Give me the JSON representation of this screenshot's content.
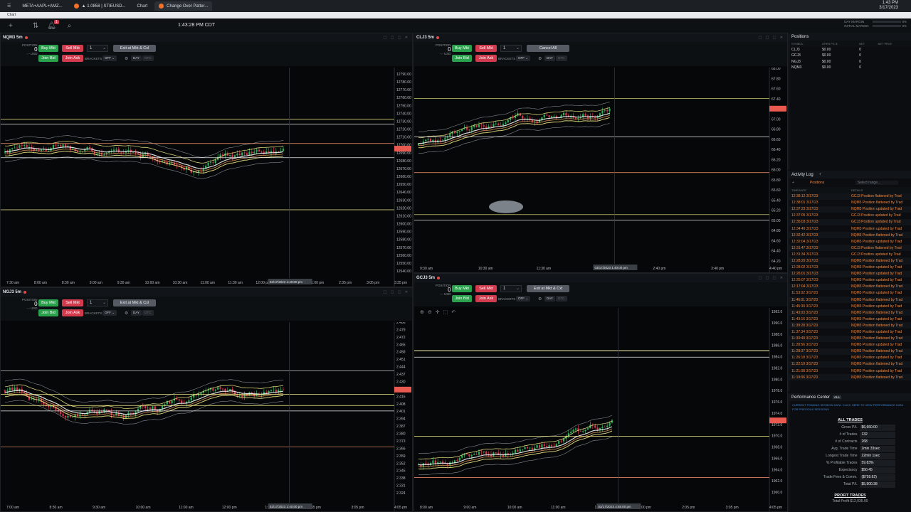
{
  "browser": {
    "tabs": [
      {
        "label": "META+AAPL+AMZ..."
      },
      {
        "label": "▲ 1.0858 | STIEUSD..."
      },
      {
        "label": "Chart"
      },
      {
        "label": "Change Over Patter..."
      }
    ],
    "clock_time": "1:43 PM",
    "clock_date": "3/17/2023",
    "address": "Chart"
  },
  "app": {
    "time": "1:43:28 PM CDT",
    "notification_count": "1",
    "day_margin_label": "DAY MARGIN",
    "day_margin_value": "0%",
    "initial_margin_label": "INITIAL MARGIN",
    "initial_margin_value": "0%"
  },
  "order_labels": {
    "buy": "Buy Mkt",
    "sell": "Sell Mkt",
    "join_bid": "Join Bid",
    "join_ask": "Join Ask",
    "position": "POSITION",
    "usd": "-.- USD",
    "brackets": "BRACKETS",
    "off": "OFF",
    "day": "DAY",
    "gtc": "GTC"
  },
  "charts": [
    {
      "symbol": "NQM3 5m",
      "qty": "1",
      "exit_label": "Exit at Mkt & Cxl",
      "position": "0",
      "y_ticks": [
        "12790.00",
        "12780.00",
        "12770.00",
        "12760.00",
        "12750.00",
        "12740.00",
        "12730.00",
        "12720.00",
        "12710.00",
        "12700.00",
        "12690.00",
        "12680.00",
        "12670.00",
        "12660.00",
        "12650.00",
        "12640.00",
        "12630.00",
        "12620.00",
        "12610.00",
        "12600.00",
        "12590.00",
        "12580.00",
        "12570.00",
        "12560.00",
        "12550.00",
        "12540.00"
      ],
      "x_ticks": [
        "7:30 am",
        "8:00 am",
        "8:30 am",
        "9:00 am",
        "9:30 am",
        "10:00 am",
        "10:30 am",
        "11:00 am",
        "11:30 am",
        "12:00 pm",
        "12:30 pm",
        "1:00 pm",
        "2:35 pm",
        "3:05 pm",
        "3:35 pm"
      ],
      "cursor_label": "03/17/2023 1:40:00 pm"
    },
    {
      "symbol": "CLJ3 5m",
      "qty": "1",
      "exit_label": "Cancel All",
      "position": "0",
      "y_ticks": [
        "68.00",
        "67.80",
        "67.60",
        "67.40",
        "67.20",
        "67.00",
        "66.80",
        "66.60",
        "66.40",
        "66.20",
        "66.00",
        "65.80",
        "65.60",
        "65.40",
        "65.20",
        "65.00",
        "64.80",
        "64.60",
        "64.40",
        "64.20"
      ],
      "x_ticks": [
        "9:30 am",
        "10:30 am",
        "11:30 am",
        "12:30 pm",
        "2:40 pm",
        "3:40 pm",
        "4:40 pm"
      ],
      "cursor_label": "03/17/2023 1:40:00 pm"
    },
    {
      "symbol": "NGJ3 5m",
      "qty": "1",
      "exit_label": "Exit at Mkt & Cxl",
      "position": "0",
      "y_ticks": [
        "2.486",
        "2.479",
        "2.472",
        "2.465",
        "2.458",
        "2.451",
        "2.444",
        "2.437",
        "2.430",
        "2.423",
        "2.416",
        "2.408",
        "2.401",
        "2.394",
        "2.387",
        "2.380",
        "2.373",
        "2.366",
        "2.359",
        "2.352",
        "2.345",
        "2.338",
        "2.331",
        "2.324"
      ],
      "x_ticks": [
        "7:00 am",
        "8:30 am",
        "9:30 am",
        "10:00 am",
        "11:00 am",
        "12:00 pm",
        "1:00 pm",
        "2:35 pm",
        "3:05 pm",
        "4:05 pm"
      ],
      "cursor_label": "03/17/2023 1:40:00 pm"
    },
    {
      "symbol": "GCJ3 5m",
      "qty": "1",
      "exit_label": "Exit at Mkt & Cxl",
      "position": "0",
      "y_ticks": [
        "1992.0",
        "1990.0",
        "1988.0",
        "1986.0",
        "1984.0",
        "1982.0",
        "1980.0",
        "1978.0",
        "1976.0",
        "1974.0",
        "1972.0",
        "1970.0",
        "1968.0",
        "1966.0",
        "1964.0",
        "1962.0",
        "1960.0"
      ],
      "x_ticks": [
        "8:00 am",
        "9:00 am",
        "10:00 am",
        "11:00 am",
        "12:00 pm",
        "1:00 pm",
        "2:05 pm",
        "3:05 pm",
        "4:05 pm"
      ],
      "cursor_label": "03/17/2023 4:55:00 pm"
    }
  ],
  "positions": {
    "title": "Positions",
    "headers": [
      "SYMBOL",
      "OPEN P/L $",
      "NET",
      "NET PROF"
    ],
    "rows": [
      {
        "symbol": "CLJ3",
        "pl": "$0.00",
        "net": "0"
      },
      {
        "symbol": "GCJ3",
        "pl": "$0.00",
        "net": "0"
      },
      {
        "symbol": "NGJ3",
        "pl": "$0.00",
        "net": "0"
      },
      {
        "symbol": "NQM3",
        "pl": "$0.00",
        "net": "0"
      }
    ]
  },
  "activity": {
    "title": "Activity Log",
    "filter": "Positions",
    "range_placeholder": "Select range...",
    "headers": [
      "TIME/DATE",
      "DETAILS"
    ],
    "rows": [
      {
        "time": "12:38:12 3/17/23",
        "detail": "GCJ3 Position flattened by Trad"
      },
      {
        "time": "12:38:01 3/17/23",
        "detail": "NQM3 Position flattened by Trad"
      },
      {
        "time": "12:37:23 3/17/23",
        "detail": "NQM3 Position updated by Trad"
      },
      {
        "time": "12:37:05 3/17/23",
        "detail": "GCJ3 Position updated by Trad"
      },
      {
        "time": "12:35:03 3/17/23",
        "detail": "GCJ3 Position updated by Trad"
      },
      {
        "time": "12:34:49 3/17/23",
        "detail": "NQM3 Position updated by Trad"
      },
      {
        "time": "12:32:42 3/17/23",
        "detail": "NQM3 Position flattened by Trad"
      },
      {
        "time": "12:32:04 3/17/23",
        "detail": "NQM3 Position updated by Trad"
      },
      {
        "time": "12:31:47 3/17/23",
        "detail": "GCJ3 Position flattened by Trad"
      },
      {
        "time": "12:31:34 3/17/23",
        "detail": "GCJ3 Position updated by Trad"
      },
      {
        "time": "12:28:29 3/17/23",
        "detail": "NQM3 Position flattened by Trad"
      },
      {
        "time": "12:28:02 3/17/23",
        "detail": "NQM3 Position updated by Trad"
      },
      {
        "time": "12:26:01 3/17/23",
        "detail": "NQM3 Position updated by Trad"
      },
      {
        "time": "12:25:07 3/17/23",
        "detail": "NQM3 Position updated by Trad"
      },
      {
        "time": "12:17:04 3/17/23",
        "detail": "NQM3 Position flattened by Trad"
      },
      {
        "time": "11:53:02 3/17/23",
        "detail": "NQM3 Position updated by Trad"
      },
      {
        "time": "11:46:01 3/17/23",
        "detail": "NQM3 Position flattened by Trad"
      },
      {
        "time": "11:45:39 3/17/23",
        "detail": "NQM3 Position updated by Trad"
      },
      {
        "time": "11:43:03 3/17/23",
        "detail": "NQM3 Position flattened by Trad"
      },
      {
        "time": "11:43:16 3/17/23",
        "detail": "NQM3 Position updated by Trad"
      },
      {
        "time": "11:39:28 3/17/23",
        "detail": "NQM3 Position flattened by Trad"
      },
      {
        "time": "11:37:34 3/17/23",
        "detail": "NQM3 Position updated by Trad"
      },
      {
        "time": "11:33:49 3/17/23",
        "detail": "NQM3 Position flattened by Trad"
      },
      {
        "time": "11:28:56 3/17/23",
        "detail": "NQM3 Position updated by Trad"
      },
      {
        "time": "11:28:37 3/17/23",
        "detail": "NQM3 Position flattened by Trad"
      },
      {
        "time": "11:26:18 3/17/23",
        "detail": "NQM3 Position updated by Trad"
      },
      {
        "time": "11:22:19 3/17/23",
        "detail": "NQM3 Position flattened by Trad"
      },
      {
        "time": "11:21:08 3/17/23",
        "detail": "NQM3 Position updated by Trad"
      },
      {
        "time": "11:19:06 3/17/23",
        "detail": "NQM3 Position flattened by Trad"
      }
    ]
  },
  "performance": {
    "title": "Performance Center",
    "scope": "ALL",
    "notice": "CURRENT TRADING SESSION DATA. CLICK HERE TO VIEW PERFORMANCE DATA FOR PREVIOUS SESSIONS",
    "section": "ALL TRADES",
    "rows": [
      {
        "label": "Gross P/L",
        "value": "$6,660.00"
      },
      {
        "label": "# of Trades",
        "value": "132"
      },
      {
        "label": "# of Contracts",
        "value": "268"
      },
      {
        "label": "Avg. Trade Time",
        "value": "2min 33sec"
      },
      {
        "label": "Longest Trade Time",
        "value": "22min 1sec"
      },
      {
        "label": "% Profitable Trades",
        "value": "59.83%"
      },
      {
        "label": "Expectancy",
        "value": "$50.45"
      },
      {
        "label": "Trade Fees & Comm.",
        "value": "($759.62)"
      },
      {
        "label": "Total P/L",
        "value": "$5,900.38"
      }
    ],
    "section2": "PROFIT TRADES",
    "partial_row": "Total Profit   $12,035.00"
  }
}
